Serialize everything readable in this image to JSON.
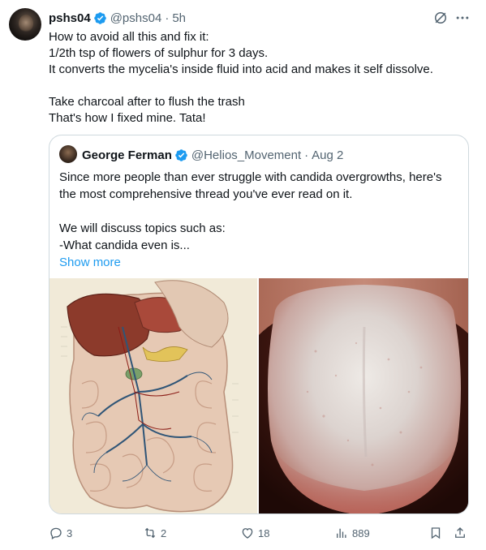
{
  "post": {
    "author": {
      "display_name": "pshs04",
      "handle": "@pshs04",
      "time": "5h"
    },
    "separator": "·",
    "lines": [
      "How to avoid all this and fix it:",
      "1/2th tsp of flowers of sulphur for 3 days.",
      "It converts the mycelia's inside fluid into acid and makes it self dissolve.",
      "",
      "Take charcoal after to flush the trash",
      "That's how I fixed mine. Tata!"
    ]
  },
  "quote": {
    "author": {
      "display_name": "George Ferman",
      "handle": "@Helios_Movement",
      "date": "Aug 2"
    },
    "separator": "·",
    "lines": [
      "Since more people than ever struggle with candida overgrowths, here's",
      "the most comprehensive thread you've ever read on it.",
      "",
      "We will discuss topics such as:",
      "-What candida even is..."
    ],
    "show_more": "Show more"
  },
  "actions": {
    "replies": "3",
    "reposts": "2",
    "likes": "18",
    "views": "889"
  },
  "colors": {
    "text": "#0f1419",
    "secondary": "#536471",
    "link": "#1d9bf0",
    "verified": "#1d9bf0",
    "border": "#cfd9de"
  },
  "icons": [
    "verified-badge-icon",
    "grok-icon",
    "more-icon",
    "reply-icon",
    "repost-icon",
    "like-icon",
    "views-icon",
    "bookmark-icon",
    "share-icon"
  ]
}
